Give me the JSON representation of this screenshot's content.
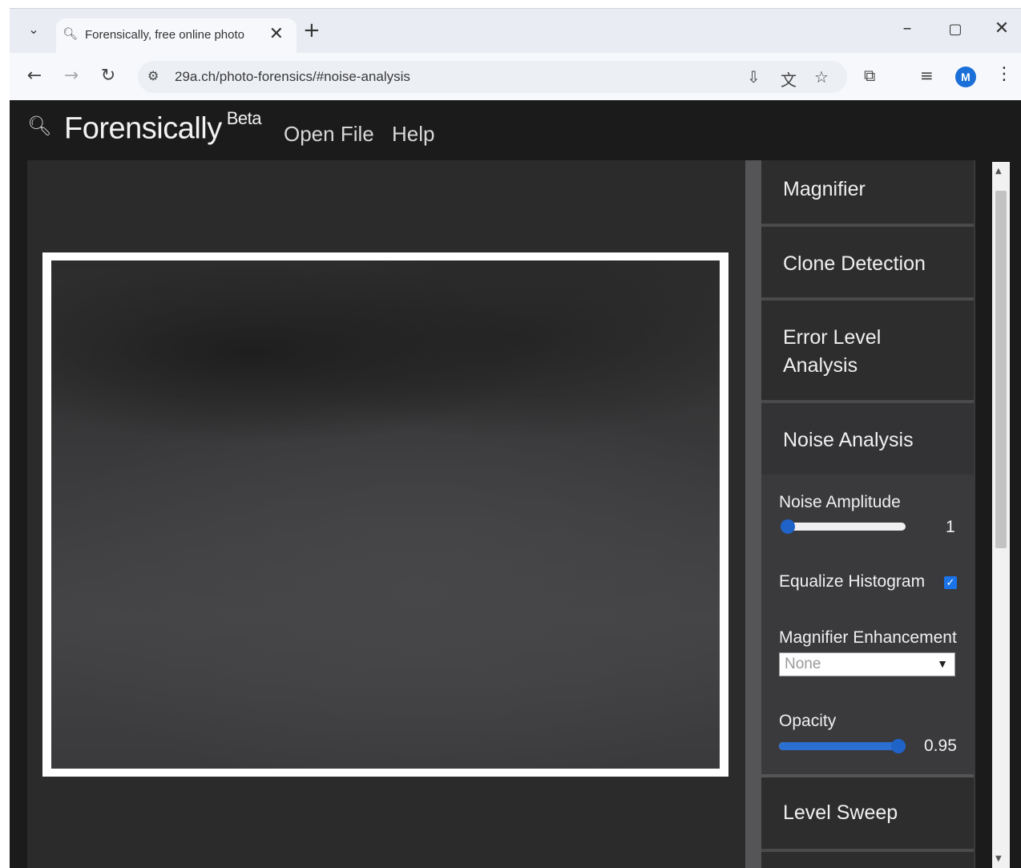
{
  "browser": {
    "tab_title": "Forensically, free online photo",
    "url": "29a.ch/photo-forensics/#noise-analysis",
    "profile_initial": "M",
    "icons": {
      "tab_list": "chevron-down",
      "tab_favicon": "magnifier",
      "tab_close": "close",
      "new_tab": "plus",
      "minimize": "minimize",
      "maximize": "maximize",
      "close_window": "close",
      "back": "arrow-left",
      "forward": "arrow-right",
      "reload": "reload",
      "site_info": "tune",
      "install": "install-app",
      "translate": "translate",
      "bookmark": "star",
      "extensions": "puzzle",
      "media": "media-controls",
      "menu": "more-vertical"
    }
  },
  "app": {
    "brand": "Forensically",
    "brand_sup": "Beta",
    "nav": {
      "open_file": "Open File",
      "help": "Help"
    },
    "tools": {
      "magnifier": "Magnifier",
      "clone_detection": "Clone Detection",
      "error_level_line1": "Error Level",
      "error_level_line2": "Analysis",
      "noise_analysis": "Noise Analysis",
      "level_sweep": "Level Sweep"
    },
    "options": {
      "noise_amplitude_label": "Noise Amplitude",
      "noise_amplitude_value": "1",
      "noise_amplitude_level": 0.0,
      "equalize_label": "Equalize Histogram",
      "equalize_checked": true,
      "magnifier_enh_label": "Magnifier Enhancement",
      "magnifier_enh_value": "None",
      "opacity_label": "Opacity",
      "opacity_value": "0.95",
      "opacity_level": 0.95
    }
  },
  "colors": {
    "accent": "#1f63c8",
    "app_bg": "#1b1b1b",
    "panel_bg": "#2d2d2d"
  }
}
